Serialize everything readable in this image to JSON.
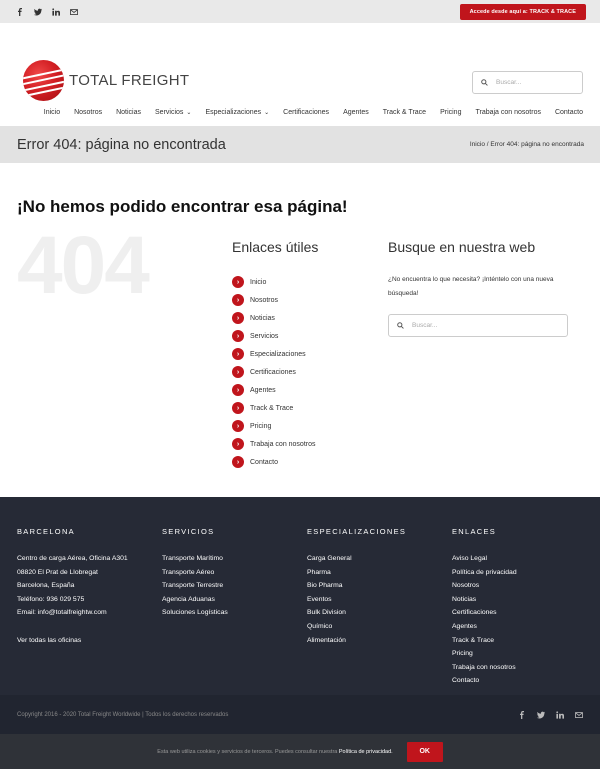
{
  "topbar": {
    "social_icons": [
      "facebook-icon",
      "twitter-icon",
      "linkedin-icon",
      "mail-icon"
    ],
    "track_button": "Accede desde aquí a: TRACK & TRACE"
  },
  "header": {
    "logo_text": "TOTAL FREIGHT",
    "search_placeholder": "Buscar..."
  },
  "nav": {
    "items": [
      "Inicio",
      "Nosotros",
      "Noticias",
      "Servicios",
      "Especializaciones",
      "Certificaciones",
      "Agentes",
      "Track & Trace",
      "Pricing",
      "Trabaja con nosotros",
      "Contacto"
    ],
    "caret": "⌄"
  },
  "titlebar": {
    "title": "Error 404: página no encontrada",
    "breadcrumb": "Inicio / Error 404: página no encontrada"
  },
  "main": {
    "heading": "¡No hemos podido encontrar esa página!",
    "big_number": "404",
    "links_title": "Enlaces útiles",
    "links": [
      "Inicio",
      "Nosotros",
      "Noticias",
      "Servicios",
      "Especializaciones",
      "Certificaciones",
      "Agentes",
      "Track & Trace",
      "Pricing",
      "Trabaja con nosotros",
      "Contacto"
    ],
    "bullet_glyph": "›",
    "search_title": "Busque en nuestra web",
    "search_text": "¿No encuentra lo que necesita? ¡Inténtelo con una nueva búsqueda!",
    "search_placeholder": "Buscar..."
  },
  "footer": {
    "columns": [
      {
        "title": "BARCELONA",
        "lines": [
          "Centro de carga Aérea, Oficina A301",
          "08820 El Prat de Llobregat",
          "Barcelona, España",
          "Teléfono: 936 029 575",
          "Email: info@totalfreightw.com",
          "",
          "Ver todas las oficinas"
        ]
      },
      {
        "title": "SERVICIOS",
        "lines": [
          "Transporte Marítimo",
          "Transporte Aéreo",
          "Transporte Terrestre",
          "Agencia Aduanas",
          "Soluciones Logísticas"
        ]
      },
      {
        "title": "ESPECIALIZACIONES",
        "lines": [
          "Carga General",
          "Pharma",
          "Bio Pharma",
          "Eventos",
          "Bulk Division",
          "Químico",
          "Alimentación"
        ]
      },
      {
        "title": "ENLACES",
        "lines": [
          "Aviso Legal",
          "Política de privacidad",
          "Nosotros",
          "Noticias",
          "Certificaciones",
          "Agentes",
          "Track & Trace",
          "Pricing",
          "Trabaja con nosotros",
          "Contacto"
        ]
      }
    ],
    "copyright": "Copyright 2016 - 2020 Total Freight Worldwide | Todos los derechos reservados",
    "social_icons": [
      "facebook-icon",
      "twitter-icon",
      "linkedin-icon",
      "mail-icon"
    ]
  },
  "cookie": {
    "text": "Esta web utiliza cookies y servicios de terceros. Puedes consultar nuestra",
    "link": "Política de privacidad.",
    "ok": "OK"
  },
  "colors": {
    "accent": "#c0151c",
    "footer_bg": "#262a36",
    "titlebar_bg": "#e2e2e2"
  }
}
